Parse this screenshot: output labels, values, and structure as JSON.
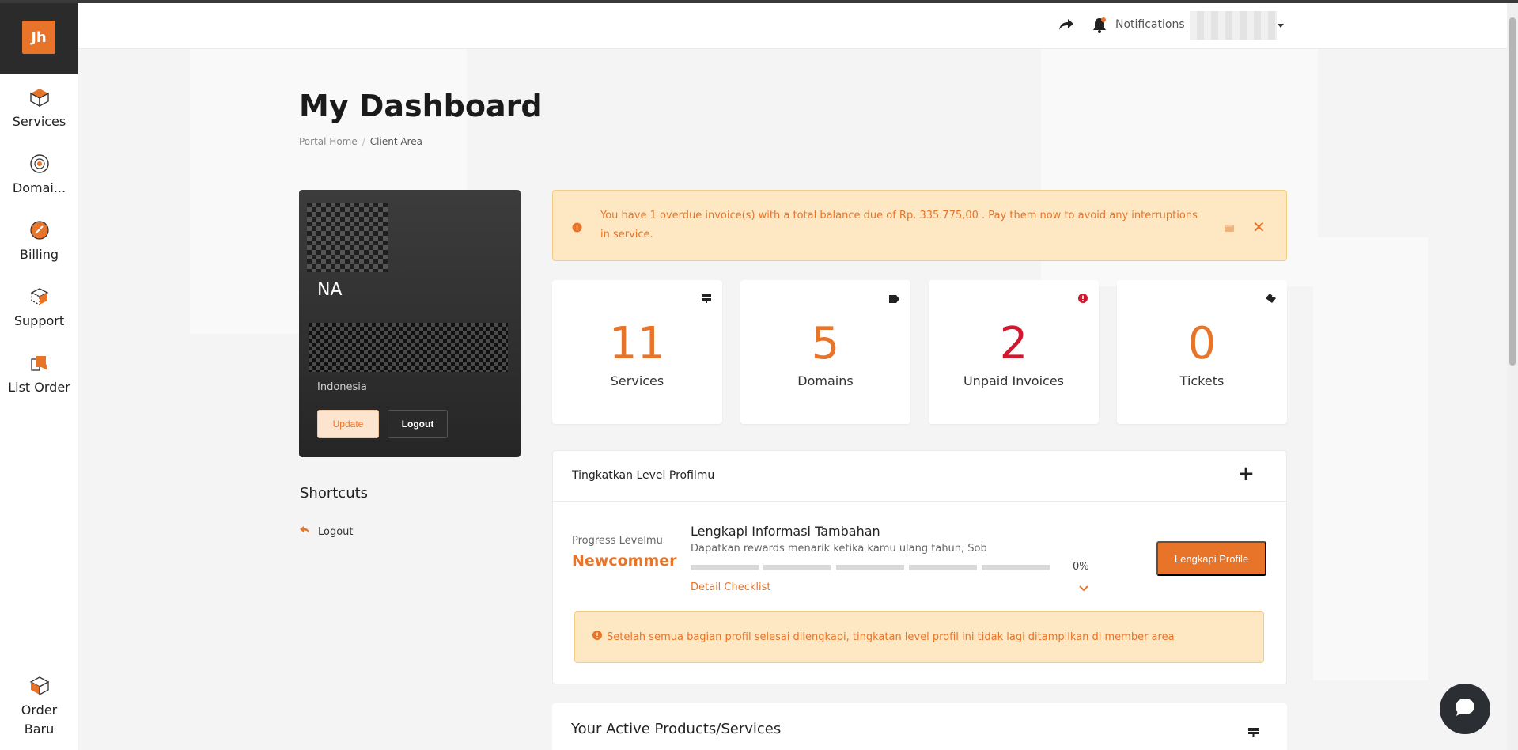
{
  "sidebar": {
    "logo": "Jh",
    "items": [
      {
        "label": "Services",
        "icon": "box-icon"
      },
      {
        "label": "Domai...",
        "icon": "globe-icon"
      },
      {
        "label": "Billing",
        "icon": "billing-icon"
      },
      {
        "label": "Support",
        "icon": "support-icon"
      },
      {
        "label": "List Order",
        "icon": "list-order-icon"
      }
    ],
    "bottom_item": {
      "label": "Order Baru",
      "icon": "order-box-icon"
    }
  },
  "topbar": {
    "notifications_label": "Notifications"
  },
  "page": {
    "title": "My Dashboard",
    "breadcrumb": [
      "Portal Home",
      "Client Area"
    ]
  },
  "profile": {
    "name": "NA",
    "country": "Indonesia",
    "update_label": "Update",
    "logout_label": "Logout"
  },
  "shortcuts": {
    "title": "Shortcuts",
    "logout_label": "Logout"
  },
  "alert": {
    "text": "You have 1 overdue invoice(s) with a total balance due of Rp. 335.775,00 . Pay them now to avoid any interruptions in service."
  },
  "stats": [
    {
      "value": "11",
      "label": "Services",
      "icon": "server-icon"
    },
    {
      "value": "5",
      "label": "Domains",
      "icon": "tag-icon"
    },
    {
      "value": "2",
      "label": "Unpaid Invoices",
      "icon": "alert-circle-icon"
    },
    {
      "value": "0",
      "label": "Tickets",
      "icon": "ticket-icon"
    }
  ],
  "level": {
    "header": "Tingkatkan Level Profilmu",
    "progress_label": "Progress Levelmu",
    "progress_value": "Newcommer",
    "info_title": "Lengkapi Informasi Tambahan",
    "info_sub": "Dapatkan rewards menarik ketika kamu ulang tahun, Sob",
    "percent": "0%",
    "detail_label": "Detail Checklist",
    "button_label": "Lengkapi Profile",
    "note": "Setelah semua bagian profil selesai dilengkapi, tingkatan level profil ini tidak lagi ditampilkan di member area"
  },
  "active_products": {
    "title": "Your Active Products/Services"
  },
  "colors": {
    "accent": "#e8742a",
    "danger": "#d0182f",
    "sidebar_logo_bg": "#2b2b2b",
    "alert_bg": "#fde8c3"
  }
}
